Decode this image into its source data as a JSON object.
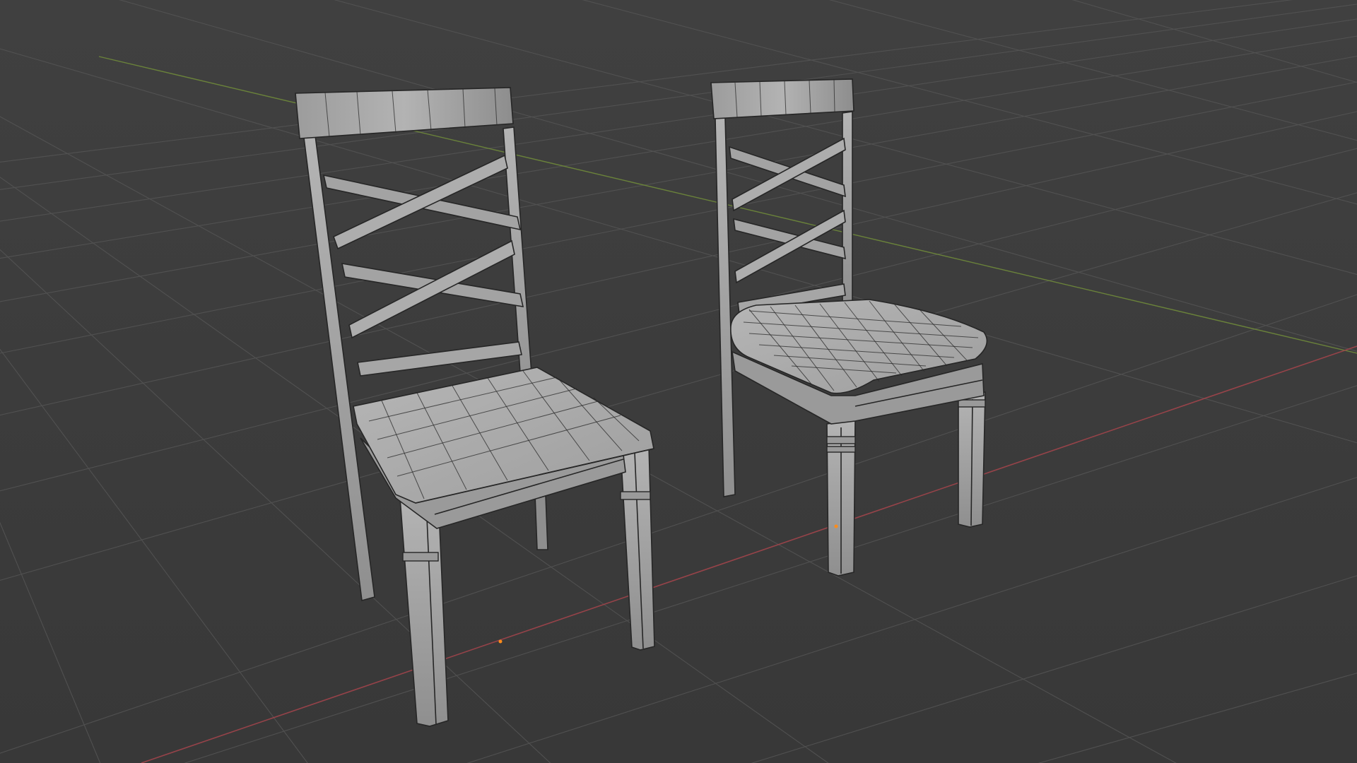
{
  "viewport": {
    "background_color": "#3d3d3d",
    "grid_color": "#555555",
    "x_axis_color": "#a0444b",
    "y_axis_color": "#6f8a3a",
    "mesh_color": "#a9a9a9",
    "wire_color": "#2a2a2a",
    "origin_marker_color": "#ff8c1a"
  },
  "objects": [
    {
      "name": "chair-left",
      "type": "mesh",
      "shading": "solid-wireframe"
    },
    {
      "name": "chair-right",
      "type": "mesh",
      "shading": "solid-wireframe"
    }
  ]
}
